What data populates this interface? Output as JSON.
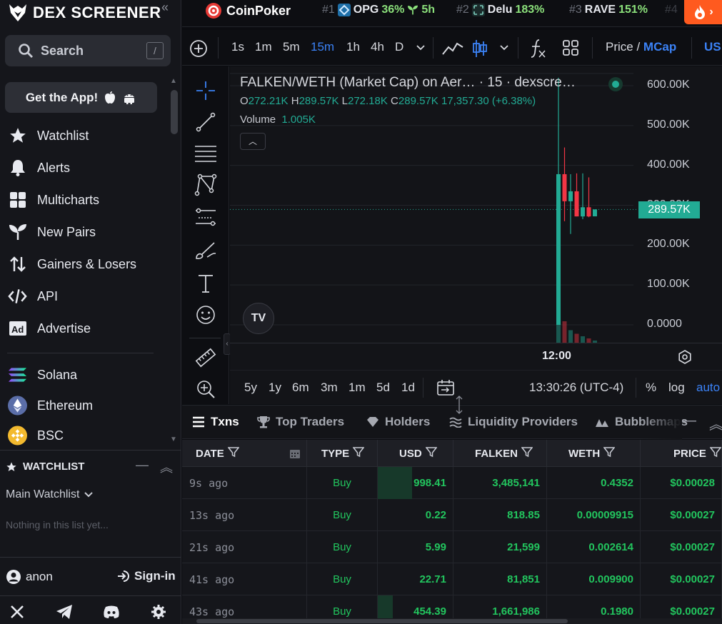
{
  "brand": {
    "name": "DEX SCREENER"
  },
  "sidebar": {
    "search": {
      "label": "Search",
      "shortcut": "/"
    },
    "get_app": "Get the App!",
    "nav": [
      {
        "label": "Watchlist",
        "icon": "star-icon"
      },
      {
        "label": "Alerts",
        "icon": "bell-icon"
      },
      {
        "label": "Multicharts",
        "icon": "grid-icon"
      },
      {
        "label": "New Pairs",
        "icon": "sprout-icon"
      },
      {
        "label": "Gainers & Losers",
        "icon": "arrows-up-down-icon"
      },
      {
        "label": "API",
        "icon": "code-icon"
      },
      {
        "label": "Advertise",
        "icon": "ad-icon"
      }
    ],
    "chains": [
      {
        "label": "Solana",
        "icon": "solana-icon",
        "color": "#9b5de5"
      },
      {
        "label": "Ethereum",
        "icon": "ethereum-icon",
        "color": "#627eea"
      },
      {
        "label": "BSC",
        "icon": "bsc-icon",
        "color": "#f3ba2f"
      }
    ],
    "watchlist": {
      "title": "WATCHLIST",
      "selected_list": "Main Watchlist",
      "empty_message": "Nothing in this list yet..."
    },
    "user": {
      "name": "anon",
      "signin": "Sign-in"
    },
    "social": [
      "x-icon",
      "telegram-icon",
      "discord-icon",
      "settings-icon"
    ]
  },
  "topbar": {
    "sponsor": "CoinPoker",
    "trending": [
      {
        "rank": "#1",
        "symbol": "OPG",
        "pct": "36%",
        "extra": "5h"
      },
      {
        "rank": "#2",
        "symbol": "Delu",
        "pct": "183%",
        "extra": ""
      },
      {
        "rank": "#3",
        "symbol": "RAVE",
        "pct": "151%",
        "extra": ""
      },
      {
        "rank": "#4",
        "symbol": "",
        "pct": "",
        "extra": ""
      }
    ]
  },
  "chart_toolbar": {
    "timeframes": [
      "1s",
      "1m",
      "5m",
      "15m",
      "1h",
      "4h",
      "D"
    ],
    "active_timeframe": "15m",
    "price_label": "Price /",
    "mcap_label": "MCap",
    "currency": "USD",
    "currency_visible": "US"
  },
  "chart": {
    "title": "FALKEN/WETH (Market Cap) on Aer… · 15 · dexscre…",
    "ohlc": {
      "o_label": "O",
      "o": "272.21K",
      "h_label": "H",
      "h": "289.57K",
      "l_label": "L",
      "l": "272.18K",
      "c_label": "C",
      "c": "289.57K",
      "change": "17,357.30 (+6.38%)"
    },
    "volume": {
      "label": "Volume",
      "value": "1.005K"
    },
    "y_ticks": [
      "600.00K",
      "500.00K",
      "400.00K",
      "300.00K",
      "200.00K",
      "100.00K",
      "0.0000"
    ],
    "last_price": "289.57K",
    "x_label": "12:00",
    "logo_text": "TV",
    "colors": {
      "up": "#22ab94",
      "down": "#f23645"
    }
  },
  "chart_data": {
    "type": "candlestick",
    "title": "FALKEN/WETH (Market Cap) on Aer… · 15 · dexscre…",
    "ylim": [
      0,
      620000
    ],
    "y_ticks": [
      600000,
      500000,
      400000,
      300000,
      200000,
      100000,
      0
    ],
    "x_ticks": [
      "12:00"
    ],
    "last": 289570,
    "candles": [
      {
        "o": 0,
        "h": 620000,
        "l": 0,
        "c": 378000,
        "vol": 0.95
      },
      {
        "o": 378000,
        "h": 445000,
        "l": 260000,
        "c": 310000,
        "vol": 0.6
      },
      {
        "o": 310000,
        "h": 378000,
        "l": 228000,
        "c": 335000,
        "vol": 0.35
      },
      {
        "o": 335000,
        "h": 380000,
        "l": 272000,
        "c": 272000,
        "vol": 0.25
      },
      {
        "o": 272000,
        "h": 380000,
        "l": 265000,
        "c": 295000,
        "vol": 0.18
      },
      {
        "o": 295000,
        "h": 370000,
        "l": 270000,
        "c": 272000,
        "vol": 0.12
      },
      {
        "o": 272210,
        "h": 289570,
        "l": 272180,
        "c": 289570,
        "vol": 0.06
      }
    ]
  },
  "range_bar": {
    "ranges": [
      "5y",
      "1y",
      "6m",
      "3m",
      "1m",
      "5d",
      "1d"
    ],
    "time": "13:30:26 (UTC-4)",
    "percent": "%",
    "log": "log",
    "auto": "auto"
  },
  "tabs": [
    {
      "label": "Txns",
      "icon": "list-icon"
    },
    {
      "label": "Top Traders",
      "icon": "trophy-icon"
    },
    {
      "label": "Holders",
      "icon": "diamond-icon"
    },
    {
      "label": "Liquidity Providers",
      "icon": "waves-icon"
    },
    {
      "label": "Bubblemaps",
      "icon": "bubbles-icon"
    }
  ],
  "table": {
    "headers": [
      "DATE",
      "TYPE",
      "USD",
      "FALKEN",
      "WETH",
      "PRICE"
    ],
    "rows": [
      {
        "date": "9s ago",
        "type": "Buy",
        "usd": "998.41",
        "falken": "3,485,141",
        "weth": "0.4352",
        "price": "$0.00028",
        "usd_frac": 0.45
      },
      {
        "date": "13s ago",
        "type": "Buy",
        "usd": "0.22",
        "falken": "818.85",
        "weth": "0.00009915",
        "price": "$0.00027",
        "usd_frac": 0
      },
      {
        "date": "21s ago",
        "type": "Buy",
        "usd": "5.99",
        "falken": "21,599",
        "weth": "0.002614",
        "price": "$0.00027",
        "usd_frac": 0
      },
      {
        "date": "41s ago",
        "type": "Buy",
        "usd": "22.71",
        "falken": "81,851",
        "weth": "0.009900",
        "price": "$0.00027",
        "usd_frac": 0
      },
      {
        "date": "43s ago",
        "type": "Buy",
        "usd": "454.39",
        "falken": "1,661,986",
        "weth": "0.1980",
        "price": "$0.00027",
        "usd_frac": 0.2
      }
    ]
  }
}
